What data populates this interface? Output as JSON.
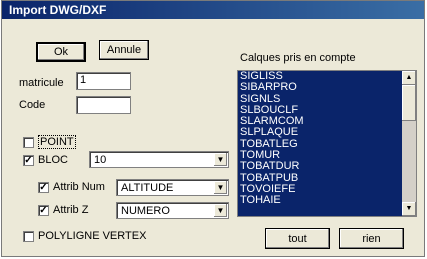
{
  "window": {
    "title": "Import DWG/DXF"
  },
  "buttons": {
    "ok": "Ok",
    "cancel": "Annule",
    "all": "tout",
    "none": "rien"
  },
  "fields": {
    "matricule": {
      "label": "matricule",
      "value": "1"
    },
    "code": {
      "label": "Code",
      "value": ""
    }
  },
  "options": {
    "point": {
      "label": "POINT",
      "checked": false
    },
    "bloc": {
      "label": "BLOC",
      "checked": true,
      "select_value": "10"
    },
    "attrib_num": {
      "label": "Attrib Num",
      "checked": true,
      "select_value": "ALTITUDE"
    },
    "attrib_z": {
      "label": "Attrib Z",
      "checked": true,
      "select_value": "NUMERO"
    },
    "polyligne": {
      "label": "POLYLIGNE VERTEX",
      "checked": false
    }
  },
  "layers": {
    "heading": "Calques pris en compte",
    "items": [
      "SIGLISS",
      "SIBARPRO",
      "SIGNLS",
      "SLBOUCLF",
      "SLARMCOM",
      "SLPLAQUE",
      "TOBATLEG",
      "TOMUR",
      "TOBATDUR",
      "TOBATPUB",
      "TOVOIEFE",
      "TOHAIE"
    ]
  },
  "icons": {
    "check": "checkmark-icon",
    "dropdown": "chevron-down-icon",
    "scroll_up": "arrow-up-icon",
    "scroll_down": "arrow-down-icon"
  },
  "colors": {
    "title_bar": "#0a246a",
    "list_selection": "#0a246a",
    "dialog_bg": "#ece9d8"
  }
}
